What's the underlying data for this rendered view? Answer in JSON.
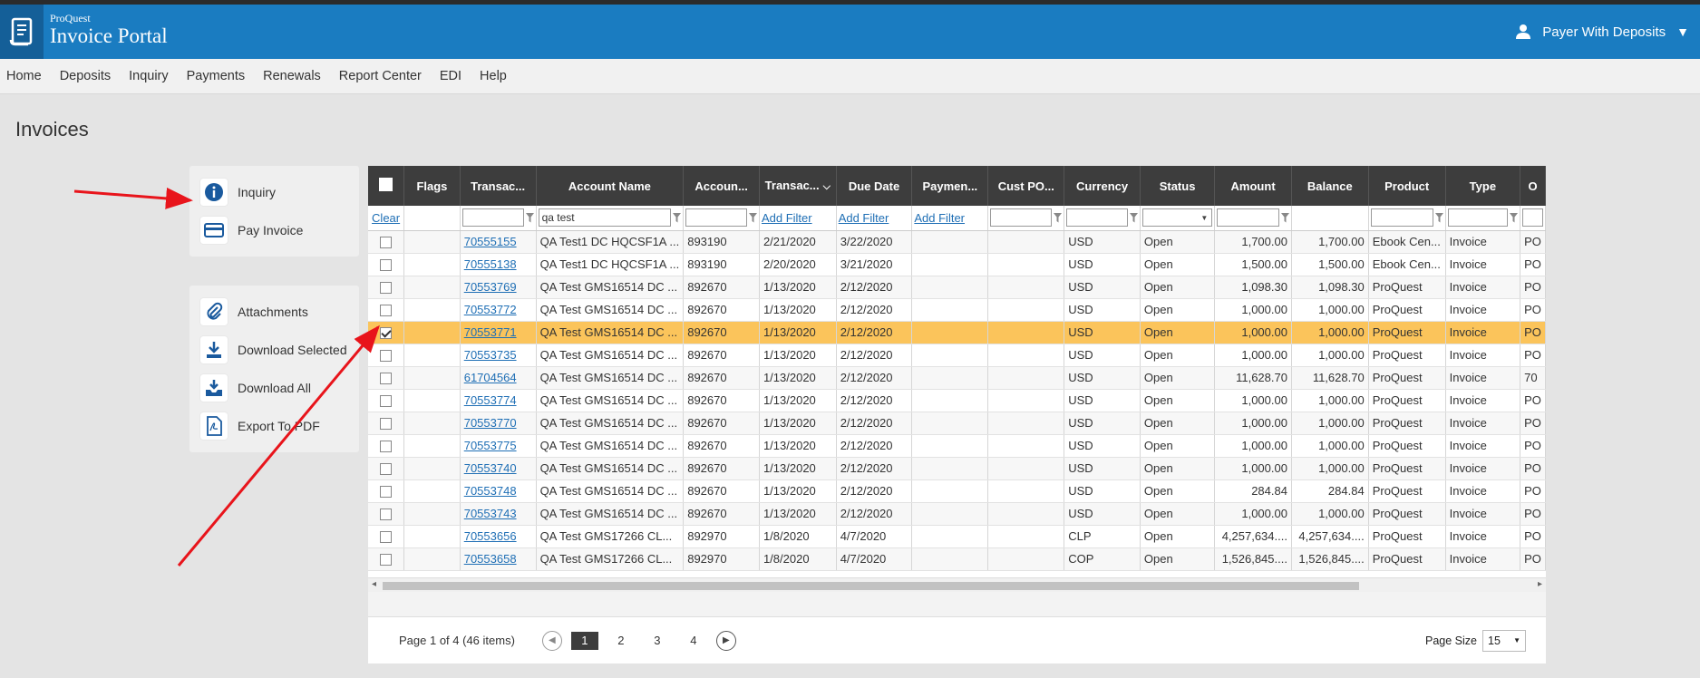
{
  "header": {
    "brand_small": "ProQuest",
    "brand_title": "Invoice Portal",
    "user_name": "Payer With Deposits"
  },
  "nav": [
    {
      "label": "Home"
    },
    {
      "label": "Deposits"
    },
    {
      "label": "Inquiry"
    },
    {
      "label": "Payments"
    },
    {
      "label": "Renewals"
    },
    {
      "label": "Report Center"
    },
    {
      "label": "EDI"
    },
    {
      "label": "Help"
    }
  ],
  "page_title": "Invoices",
  "actions_top": [
    {
      "label": "Inquiry",
      "icon": "info-icon"
    },
    {
      "label": "Pay Invoice",
      "icon": "credit-card-icon"
    }
  ],
  "actions_bottom": [
    {
      "label": "Attachments",
      "icon": "paperclip-icon"
    },
    {
      "label": "Download Selected",
      "icon": "download-icon"
    },
    {
      "label": "Download All",
      "icon": "download-all-icon"
    },
    {
      "label": "Export To PDF",
      "icon": "pdf-icon"
    }
  ],
  "grid": {
    "columns": [
      "",
      "Flags",
      "Transac...",
      "Account Name",
      "Accoun...",
      "Transac...",
      "Due Date",
      "Paymen...",
      "Cust PO...",
      "Currency",
      "Status",
      "Amount",
      "Balance",
      "Product",
      "Type",
      "O"
    ],
    "filters": {
      "clear": "Clear",
      "account_name_value": "qa test",
      "add_filter": "Add Filter"
    },
    "rows": [
      {
        "txn": "70555155",
        "account": "QA Test1 DC HQCSF1A ...",
        "acct_no": "893190",
        "txn_date": "2/21/2020",
        "due": "3/22/2020",
        "currency": "USD",
        "status": "Open",
        "amount": "1,700.00",
        "balance": "1,700.00",
        "product": "Ebook Cen...",
        "type": "Invoice",
        "o": "PO",
        "selected": false
      },
      {
        "txn": "70555138",
        "account": "QA Test1 DC HQCSF1A ...",
        "acct_no": "893190",
        "txn_date": "2/20/2020",
        "due": "3/21/2020",
        "currency": "USD",
        "status": "Open",
        "amount": "1,500.00",
        "balance": "1,500.00",
        "product": "Ebook Cen...",
        "type": "Invoice",
        "o": "PO",
        "selected": false
      },
      {
        "txn": "70553769",
        "account": "QA Test GMS16514 DC ...",
        "acct_no": "892670",
        "txn_date": "1/13/2020",
        "due": "2/12/2020",
        "currency": "USD",
        "status": "Open",
        "amount": "1,098.30",
        "balance": "1,098.30",
        "product": "ProQuest",
        "type": "Invoice",
        "o": "PO",
        "selected": false
      },
      {
        "txn": "70553772",
        "account": "QA Test GMS16514 DC ...",
        "acct_no": "892670",
        "txn_date": "1/13/2020",
        "due": "2/12/2020",
        "currency": "USD",
        "status": "Open",
        "amount": "1,000.00",
        "balance": "1,000.00",
        "product": "ProQuest",
        "type": "Invoice",
        "o": "PO",
        "selected": false
      },
      {
        "txn": "70553771",
        "account": "QA Test GMS16514 DC ...",
        "acct_no": "892670",
        "txn_date": "1/13/2020",
        "due": "2/12/2020",
        "currency": "USD",
        "status": "Open",
        "amount": "1,000.00",
        "balance": "1,000.00",
        "product": "ProQuest",
        "type": "Invoice",
        "o": "PO",
        "selected": true
      },
      {
        "txn": "70553735",
        "account": "QA Test GMS16514 DC ...",
        "acct_no": "892670",
        "txn_date": "1/13/2020",
        "due": "2/12/2020",
        "currency": "USD",
        "status": "Open",
        "amount": "1,000.00",
        "balance": "1,000.00",
        "product": "ProQuest",
        "type": "Invoice",
        "o": "PO",
        "selected": false
      },
      {
        "txn": "61704564",
        "account": "QA Test GMS16514 DC ...",
        "acct_no": "892670",
        "txn_date": "1/13/2020",
        "due": "2/12/2020",
        "currency": "USD",
        "status": "Open",
        "amount": "11,628.70",
        "balance": "11,628.70",
        "product": "ProQuest",
        "type": "Invoice",
        "o": "70",
        "selected": false
      },
      {
        "txn": "70553774",
        "account": "QA Test GMS16514 DC ...",
        "acct_no": "892670",
        "txn_date": "1/13/2020",
        "due": "2/12/2020",
        "currency": "USD",
        "status": "Open",
        "amount": "1,000.00",
        "balance": "1,000.00",
        "product": "ProQuest",
        "type": "Invoice",
        "o": "PO",
        "selected": false
      },
      {
        "txn": "70553770",
        "account": "QA Test GMS16514 DC ...",
        "acct_no": "892670",
        "txn_date": "1/13/2020",
        "due": "2/12/2020",
        "currency": "USD",
        "status": "Open",
        "amount": "1,000.00",
        "balance": "1,000.00",
        "product": "ProQuest",
        "type": "Invoice",
        "o": "PO",
        "selected": false
      },
      {
        "txn": "70553775",
        "account": "QA Test GMS16514 DC ...",
        "acct_no": "892670",
        "txn_date": "1/13/2020",
        "due": "2/12/2020",
        "currency": "USD",
        "status": "Open",
        "amount": "1,000.00",
        "balance": "1,000.00",
        "product": "ProQuest",
        "type": "Invoice",
        "o": "PO",
        "selected": false
      },
      {
        "txn": "70553740",
        "account": "QA Test GMS16514 DC ...",
        "acct_no": "892670",
        "txn_date": "1/13/2020",
        "due": "2/12/2020",
        "currency": "USD",
        "status": "Open",
        "amount": "1,000.00",
        "balance": "1,000.00",
        "product": "ProQuest",
        "type": "Invoice",
        "o": "PO",
        "selected": false
      },
      {
        "txn": "70553748",
        "account": "QA Test GMS16514 DC ...",
        "acct_no": "892670",
        "txn_date": "1/13/2020",
        "due": "2/12/2020",
        "currency": "USD",
        "status": "Open",
        "amount": "284.84",
        "balance": "284.84",
        "product": "ProQuest",
        "type": "Invoice",
        "o": "PO",
        "selected": false
      },
      {
        "txn": "70553743",
        "account": "QA Test GMS16514 DC ...",
        "acct_no": "892670",
        "txn_date": "1/13/2020",
        "due": "2/12/2020",
        "currency": "USD",
        "status": "Open",
        "amount": "1,000.00",
        "balance": "1,000.00",
        "product": "ProQuest",
        "type": "Invoice",
        "o": "PO",
        "selected": false
      },
      {
        "txn": "70553656",
        "account": "QA Test GMS17266 CL...",
        "acct_no": "892970",
        "txn_date": "1/8/2020",
        "due": "4/7/2020",
        "currency": "CLP",
        "status": "Open",
        "amount": "4,257,634....",
        "balance": "4,257,634....",
        "product": "ProQuest",
        "type": "Invoice",
        "o": "PO",
        "selected": false
      },
      {
        "txn": "70553658",
        "account": "QA Test GMS17266 CL...",
        "acct_no": "892970",
        "txn_date": "1/8/2020",
        "due": "4/7/2020",
        "currency": "COP",
        "status": "Open",
        "amount": "1,526,845....",
        "balance": "1,526,845....",
        "product": "ProQuest",
        "type": "Invoice",
        "o": "PO",
        "selected": false
      }
    ]
  },
  "pager": {
    "info": "Page 1 of 4 (46 items)",
    "pages": [
      "1",
      "2",
      "3",
      "4"
    ],
    "size_label": "Page Size",
    "size_value": "15"
  },
  "colors": {
    "header_blue": "#1a7cc1",
    "selected_row": "#fbc45b",
    "annotation_arrow": "#e8141b"
  }
}
